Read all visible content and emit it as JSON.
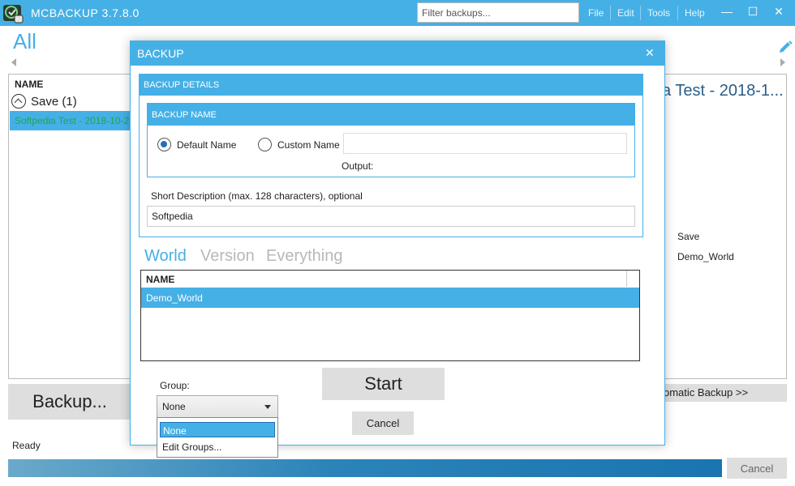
{
  "app": {
    "title": "MCBACKUP 3.7.8.0",
    "filter_placeholder": "Filter backups..."
  },
  "menu": [
    "File",
    "Edit",
    "Tools",
    "Help"
  ],
  "window_controls": {
    "minimize": "—",
    "maximize": "☐",
    "close": "✕"
  },
  "main": {
    "heading": "All",
    "column_name": "NAME",
    "group_label": "Save (1)",
    "selected_item": "Softpedia Test - 2018-10-2",
    "detail_heading": "a Test - 2018-1...",
    "detail_save": "Save",
    "detail_world": "Demo_World",
    "backup_button": "Backup...",
    "automatic_backup": "omatic Backup >>",
    "status": "Ready",
    "cancel_button": "Cancel"
  },
  "dialog": {
    "title": "BACKUP",
    "close": "✕",
    "details_header": "BACKUP DETAILS",
    "name_header": "BACKUP NAME",
    "default_name": "Default Name",
    "custom_name": "Custom Name",
    "output_label": "Output:",
    "short_desc_label": "Short Description (max. 128 characters), optional",
    "short_desc_value": "Softpedia",
    "tabs": [
      "World",
      "Version",
      "Everything"
    ],
    "table_header": "NAME",
    "table_rows": [
      "Demo_World"
    ],
    "group_label": "Group:",
    "group_selected": "None",
    "group_options": [
      "None",
      "Edit Groups..."
    ],
    "start_button": "Start",
    "cancel_button": "Cancel"
  }
}
